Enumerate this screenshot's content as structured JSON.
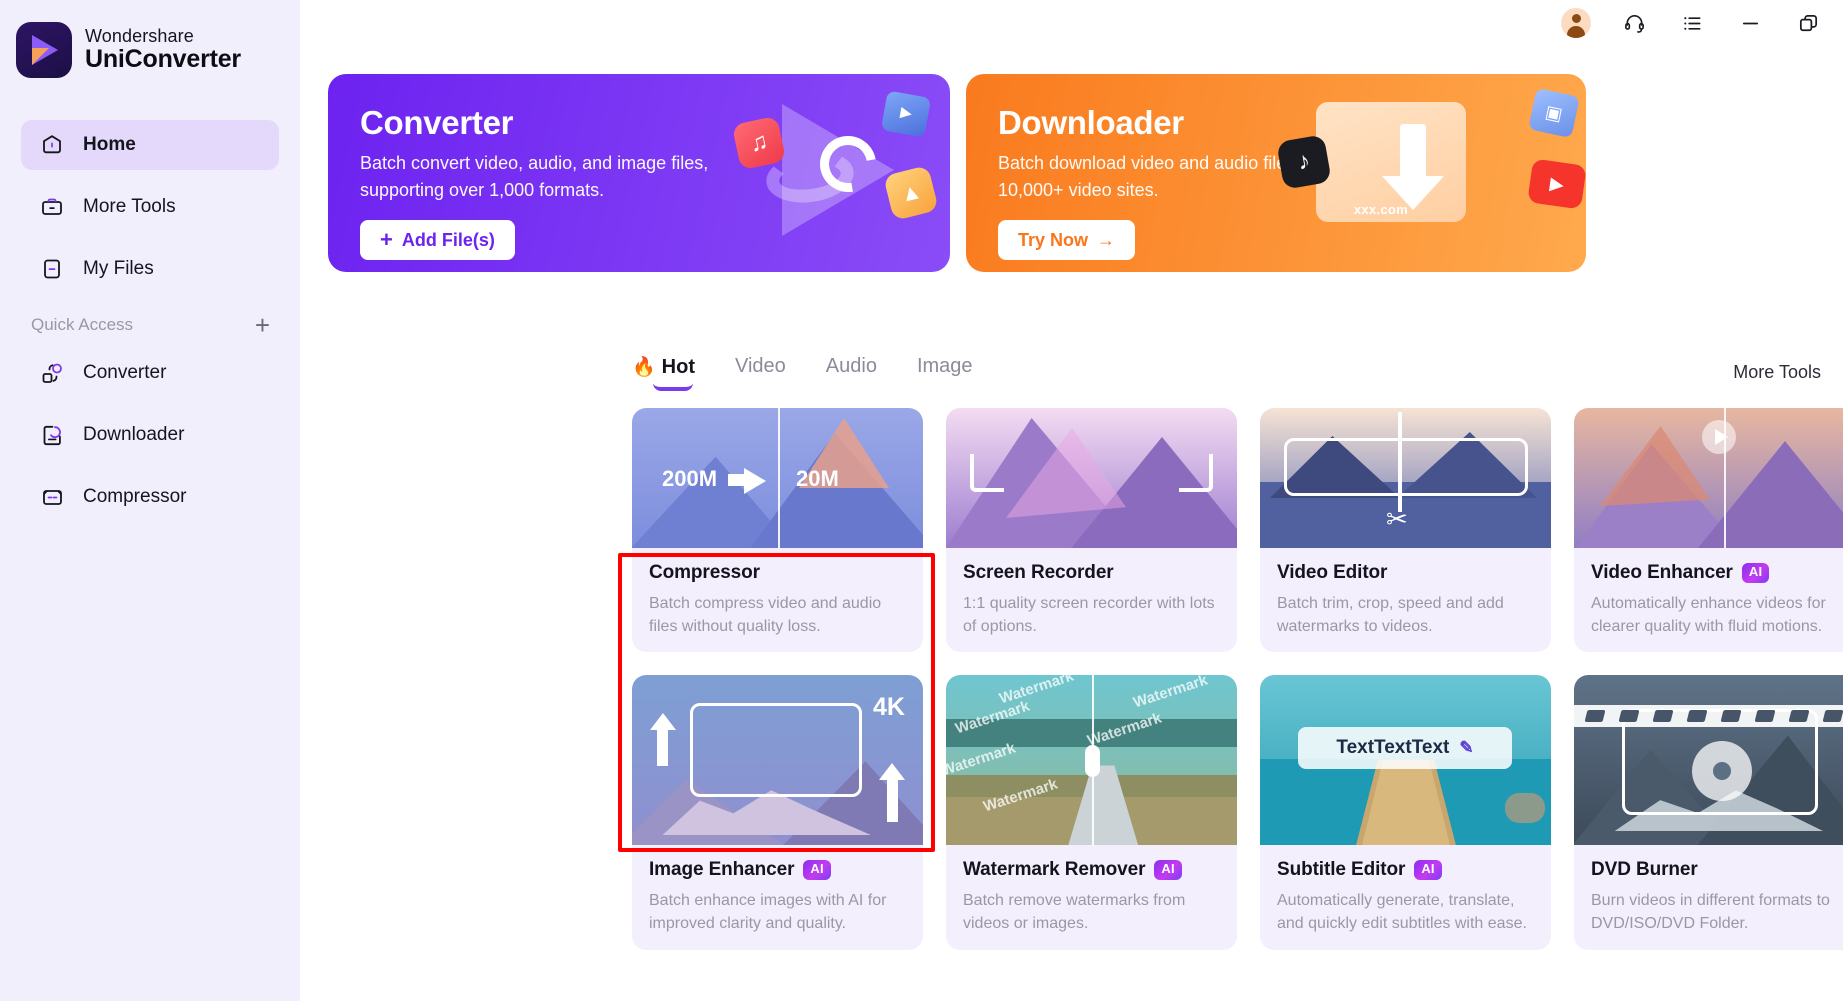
{
  "app": {
    "brand_line1": "Wondershare",
    "brand_line2": "UniConverter"
  },
  "titlebar": {
    "avatar": "user-avatar",
    "support_icon": "headset-icon",
    "tasks_icon": "list-icon",
    "minimize_icon": "minimize-icon",
    "restore_icon": "restore-icon"
  },
  "sidebar": {
    "items": [
      {
        "label": "Home",
        "icon": "home-icon",
        "active": true
      },
      {
        "label": "More Tools",
        "icon": "toolbox-icon",
        "active": false
      },
      {
        "label": "My Files",
        "icon": "files-icon",
        "active": false
      }
    ],
    "quick_access": {
      "label": "Quick Access",
      "add_icon": "plus-icon",
      "items": [
        {
          "label": "Converter",
          "icon": "converter-icon"
        },
        {
          "label": "Downloader",
          "icon": "downloader-icon"
        },
        {
          "label": "Compressor",
          "icon": "compressor-icon"
        }
      ]
    }
  },
  "banners": [
    {
      "title": "Converter",
      "desc": "Batch convert video, audio, and image files, supporting over 1,000 formats.",
      "button": "Add File(s)",
      "button_icon": "plus-icon",
      "color": "#6d22f0"
    },
    {
      "title": "Downloader",
      "desc": "Batch download video and audio files from 10,000+ video sites.",
      "button": "Try Now",
      "button_icon": "arrow-right-icon",
      "color": "#fa7a1e",
      "art_label": "xxx.com"
    }
  ],
  "tabs": {
    "items": [
      {
        "label": "Hot",
        "icon": "fire-icon",
        "active": true
      },
      {
        "label": "Video",
        "active": false
      },
      {
        "label": "Audio",
        "active": false
      },
      {
        "label": "Image",
        "active": false
      }
    ],
    "more_tools_link": "More Tools"
  },
  "cards": [
    {
      "title": "Compressor",
      "badge": "",
      "desc": "Batch compress video and audio files without quality loss.",
      "thumb_labels": [
        "200M",
        "20M"
      ],
      "thumb": "compressor"
    },
    {
      "title": "Screen Recorder",
      "badge": "",
      "desc": "1:1 quality screen recorder with lots of options.",
      "thumb_labels": [],
      "thumb": "screen-recorder"
    },
    {
      "title": "Video Editor",
      "badge": "",
      "desc": "Batch trim, crop, speed and add watermarks to videos.",
      "thumb_labels": [],
      "thumb": "video-editor"
    },
    {
      "title": "Video Enhancer",
      "badge": "AI",
      "desc": "Automatically enhance videos for clearer quality with fluid motions.",
      "thumb_labels": [],
      "thumb": "video-enhancer"
    },
    {
      "title": "Image Enhancer",
      "badge": "AI",
      "desc": "Batch enhance images with AI for improved clarity and quality.",
      "thumb_labels": [
        "4K"
      ],
      "thumb": "image-enhancer",
      "highlighted": true
    },
    {
      "title": "Watermark Remover",
      "badge": "AI",
      "desc": "Batch remove watermarks from videos or images.",
      "thumb_labels": [
        "Watermark"
      ],
      "thumb": "watermark-remover"
    },
    {
      "title": "Subtitle Editor",
      "badge": "AI",
      "desc": "Automatically generate, translate, and quickly edit subtitles with ease.",
      "thumb_labels": [
        "TextTextText"
      ],
      "thumb": "subtitle-editor"
    },
    {
      "title": "DVD Burner",
      "badge": "",
      "desc": "Burn videos in different formats to DVD/ISO/DVD Folder.",
      "thumb_labels": [],
      "thumb": "dvd-burner"
    }
  ],
  "colors": {
    "accent": "#7c3aed",
    "banner_purple": "#6d22f0",
    "banner_orange": "#fa7a1e",
    "highlight": "#ff0000",
    "sidebar_bg": "#f2effc",
    "card_bg": "#f3effd"
  }
}
